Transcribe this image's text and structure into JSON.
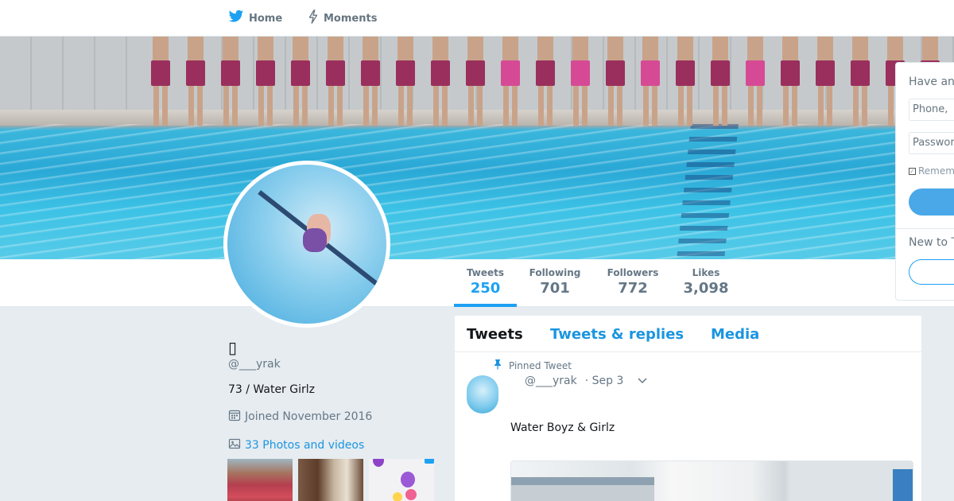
{
  "nav": {
    "home_label": "Home",
    "moments_label": "Moments"
  },
  "icons": {
    "home": "twitter-bird-icon",
    "moments": "lightning-icon",
    "calendar": "calendar-icon",
    "photo": "photo-icon",
    "pin": "pin-icon",
    "caret": "chevron-down-icon"
  },
  "colors": {
    "accent": "#1da1f2",
    "link": "#1b95e0",
    "muted": "#657786",
    "background": "#e6ecf0"
  },
  "stats": [
    {
      "label": "Tweets",
      "value": "250"
    },
    {
      "label": "Following",
      "value": "701"
    },
    {
      "label": "Followers",
      "value": "772"
    },
    {
      "label": "Likes",
      "value": "3,098"
    }
  ],
  "login": {
    "heading": "Have an",
    "phone_placeholder": "Phone,",
    "password_placeholder": "Passwor",
    "remember_label": "Remem",
    "new_to_label": "New to T"
  },
  "profile": {
    "fullname": "▯",
    "handle": "@___yrak",
    "bio": "73  / Water Girlz",
    "joined": "Joined November 2016",
    "photos_link": "33 Photos and videos"
  },
  "timeline": {
    "tabs": [
      {
        "label": "Tweets"
      },
      {
        "label": "Tweets & replies"
      },
      {
        "label": "Media"
      }
    ],
    "tweet": {
      "pinned_label": "Pinned Tweet",
      "handle": "@___yrak",
      "time": "· Sep 3",
      "text": "Water Boyz & Girlz"
    }
  }
}
